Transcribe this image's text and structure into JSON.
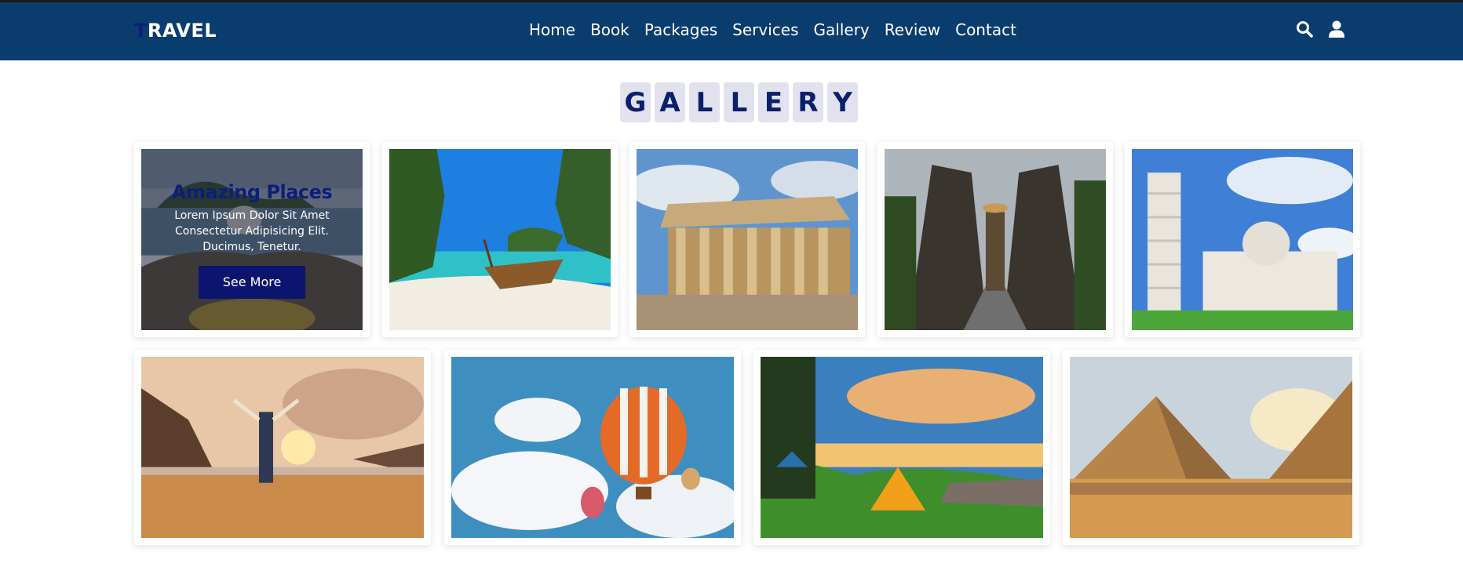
{
  "header": {
    "logo_first": "T",
    "logo_rest": "RAVEL",
    "nav": [
      "Home",
      "Book",
      "Packages",
      "Services",
      "Gallery",
      "Review",
      "Contact"
    ]
  },
  "section_title_letters": [
    "G",
    "A",
    "L",
    "L",
    "E",
    "R",
    "Y"
  ],
  "gallery": {
    "featured": {
      "title": "Amazing Places",
      "text_lines": [
        "Lorem Ipsum Dolor Sit Amet",
        "Consectetur Adipisicing Elit.",
        "Ducimus, Tenetur."
      ],
      "button": "See More"
    },
    "photos": [
      "tropical-lagoon-longtail-boat",
      "parthenon-ruins",
      "temple-gate-traveler",
      "leaning-tower-of-pisa",
      "beach-sunset-hiker",
      "hot-air-balloons",
      "mountain-campsite",
      "pyramids-of-giza"
    ]
  },
  "colors": {
    "header_bg": "#0b3c6e",
    "accent": "#0b1f7a",
    "title_tile": "#e1e2ee",
    "button": "#0b1570"
  }
}
